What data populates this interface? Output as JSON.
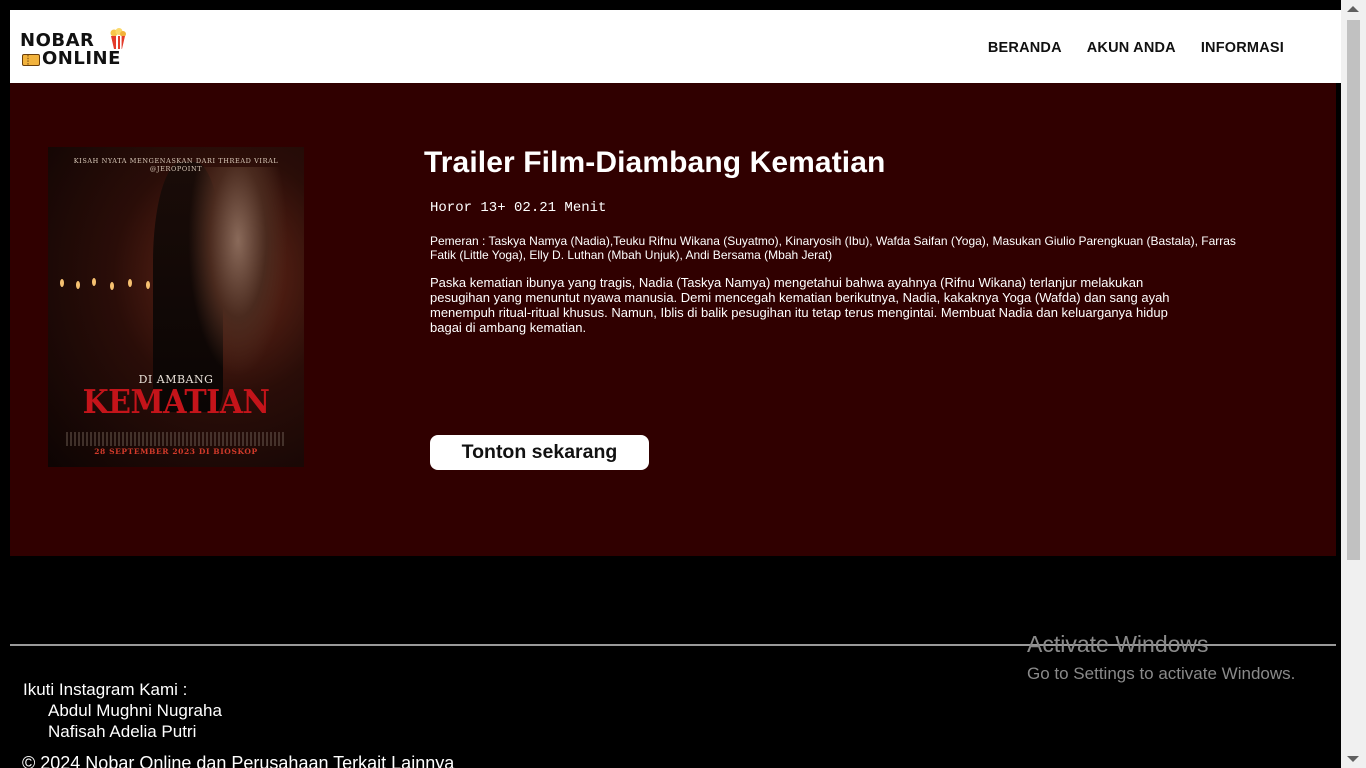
{
  "header": {
    "logo": {
      "line1": "NOBAR",
      "line2": "ONLINE"
    },
    "nav": [
      "BERANDA",
      "AKUN ANDA",
      "INFORMASI"
    ]
  },
  "film": {
    "title": "Trailer Film-Diambang Kematian",
    "meta": "Horor 13+ 02.21 Menit",
    "cast": "Pemeran : Taskya Namya (Nadia),Teuku Rifnu Wikana (Suyatmo), Kinaryosih (Ibu), Wafda Saifan (Yoga), Masukan Giulio Parengkuan (Bastala), Farras Fatik (Little Yoga), Elly D. Luthan (Mbah Unjuk), Andi Bersama (Mbah Jerat)",
    "synopsis": "Paska kematian ibunya yang tragis, Nadia (Taskya Namya) mengetahui bahwa ayahnya (Rifnu Wikana) terlanjur melakukan pesugihan yang menuntut nyawa manusia. Demi mencegah kematian berikutnya, Nadia, kakaknya Yoga (Wafda) dan sang ayah menempuh ritual-ritual khusus. Namun, Iblis di balik pesugihan itu tetap terus mengintai. Membuat Nadia dan keluarganya hidup bagai di ambang kematian.",
    "watch_button": "Tonton sekarang",
    "poster": {
      "tagline": "KISAH NYATA MENGENASKAN DARI THREAD VIRAL @JEROPOINT",
      "subtitle": "DI AMBANG",
      "title": "KEMATIAN",
      "date": "28 SEPTEMBER 2023 DI BIOSKOP"
    }
  },
  "footer": {
    "instagram_label": "Ikuti Instagram Kami :",
    "names": [
      "Abdul Mughni Nugraha",
      "Nafisah Adelia Putri"
    ],
    "copyright": "© 2024 Nobar Online dan Perusahaan Terkait Lainnya"
  },
  "overlay": {
    "activate_title": "Activate Windows",
    "activate_sub": "Go to Settings to activate Windows."
  },
  "colors": {
    "main_bg": "#300000",
    "page_bg": "#000000",
    "header_bg": "#ffffff",
    "poster_title": "#c4141a"
  }
}
